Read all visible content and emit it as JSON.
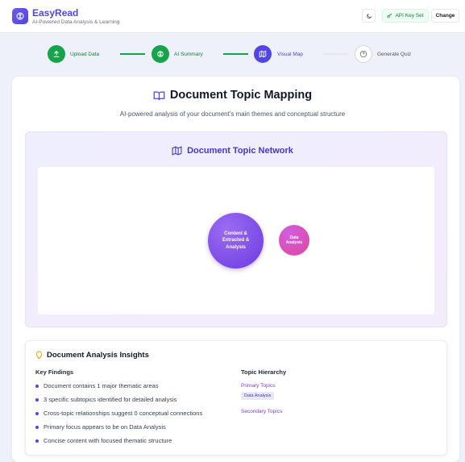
{
  "header": {
    "app_name": "EasyRead",
    "tagline": "AI-Powered Data Analysis & Learning",
    "api_status": "API Key Set",
    "change_label": "Change"
  },
  "stepper": {
    "steps": [
      {
        "label": "Upload Data",
        "state": "complete",
        "icon": "upload-icon"
      },
      {
        "label": "AI Summary",
        "state": "complete",
        "icon": "brain-icon"
      },
      {
        "label": "Visual Map",
        "state": "active",
        "icon": "map-icon"
      },
      {
        "label": "Generate Quiz",
        "state": "pending",
        "icon": "question-icon"
      }
    ]
  },
  "mapping": {
    "title": "Document Topic Mapping",
    "subtitle": "AI-powered analysis of your document's main themes and conceptual structure"
  },
  "network": {
    "title": "Document Topic Network",
    "nodes": [
      {
        "label": "Content & Extracted & Analysis",
        "role": "main"
      },
      {
        "label": "Data Analysis",
        "role": "subtopic"
      }
    ]
  },
  "insights": {
    "title": "Document Analysis Insights",
    "key_findings_heading": "Key Findings",
    "findings": [
      "Document contains 1 major thematic areas",
      "3 specific subtopics identified for detailed analysis",
      "Cross-topic relationships suggest 0 conceptual connections",
      "Primary focus appears to be on Data Analysis",
      "Concise content with focused thematic structure"
    ],
    "hierarchy_heading": "Topic Hierarchy",
    "primary_label": "Primary Topics",
    "primary_tags": [
      "Data Analysis"
    ],
    "secondary_label": "Secondary Topics"
  },
  "colors": {
    "accent": "#4f46e5",
    "complete": "#16a34a",
    "active": "#4f46e5",
    "pending_border": "#d1d5db",
    "node_main": "#7c3aed",
    "node_sub": "#db2777"
  }
}
